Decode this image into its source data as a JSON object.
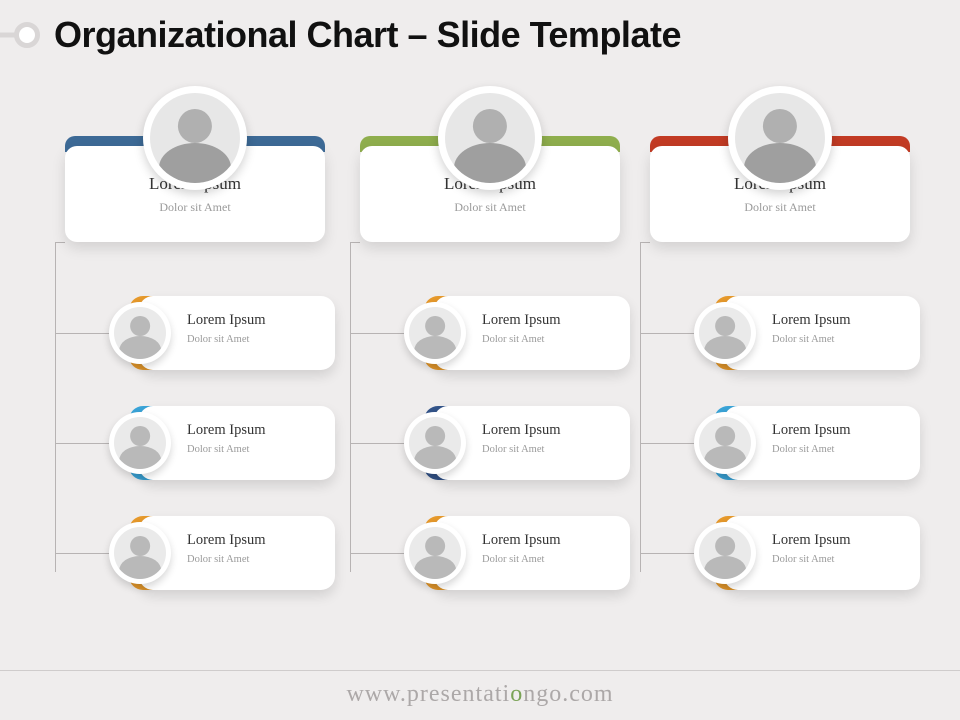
{
  "title": "Organizational Chart – Slide Template",
  "footer_prefix": "www.presentati",
  "footer_o": "o",
  "footer_suffix": "ngo.com",
  "columns": [
    {
      "accent": "#3d6a96",
      "lead": {
        "name": "Lorem Ipsum",
        "role": "Dolor sit Amet"
      },
      "children": [
        {
          "name": "Lorem Ipsum",
          "role": "Dolor sit Amet",
          "accent": "#e79a2c"
        },
        {
          "name": "Lorem Ipsum",
          "role": "Dolor sit Amet",
          "accent": "#3aa4d8"
        },
        {
          "name": "Lorem Ipsum",
          "role": "Dolor sit Amet",
          "accent": "#e79a2c"
        }
      ]
    },
    {
      "accent": "#8fae4d",
      "lead": {
        "name": "Lorem Ipsum",
        "role": "Dolor sit Amet"
      },
      "children": [
        {
          "name": "Lorem Ipsum",
          "role": "Dolor sit Amet",
          "accent": "#e79a2c"
        },
        {
          "name": "Lorem Ipsum",
          "role": "Dolor sit Amet",
          "accent": "#33548a"
        },
        {
          "name": "Lorem Ipsum",
          "role": "Dolor sit Amet",
          "accent": "#e79a2c"
        }
      ]
    },
    {
      "accent": "#c23b24",
      "lead": {
        "name": "Lorem Ipsum",
        "role": "Dolor sit Amet"
      },
      "children": [
        {
          "name": "Lorem Ipsum",
          "role": "Dolor sit Amet",
          "accent": "#e79a2c"
        },
        {
          "name": "Lorem Ipsum",
          "role": "Dolor sit Amet",
          "accent": "#3aa4d8"
        },
        {
          "name": "Lorem Ipsum",
          "role": "Dolor sit Amet",
          "accent": "#e79a2c"
        }
      ]
    }
  ]
}
